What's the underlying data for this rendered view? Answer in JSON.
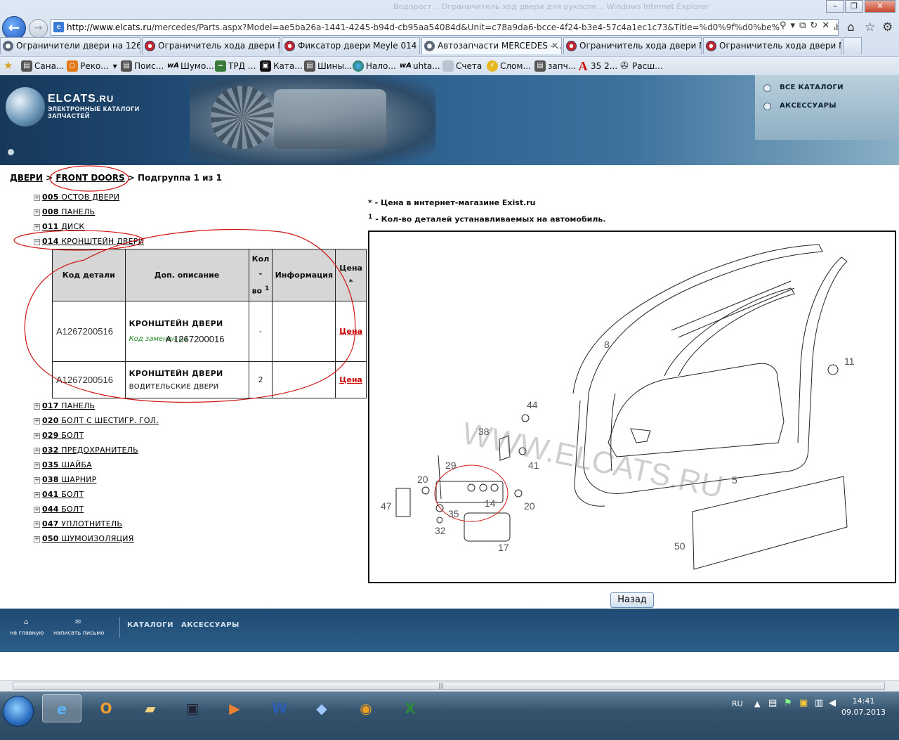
{
  "browser": {
    "url_domain": "http://www.elcats.ru",
    "url_rest": "/mercedes/Parts.aspx?Model=ae5ba26a-1441-4245-b94d-cb95aa54084d&Unit=c78a9da6-bcce-4f24-b3e4-57c4a1ec1c73&Title=%d0%9f%d0%be%d0%b4%d0%b3%d1%80%",
    "title_faded": "Водорост... Ограничитель ход двери для рукоспе... Windows Internet Explorer",
    "tabs": [
      {
        "label": "Ограничители двери на 126 л...",
        "active": false
      },
      {
        "label": "Ограничитель хода двери Ме...",
        "active": false
      },
      {
        "label": "Фиксатор двери Meyle 014 07...",
        "active": false
      },
      {
        "label": "Автозапчасти MERCEDES - ...",
        "active": true,
        "close": "✕"
      },
      {
        "label": "Ограничитель хода двери Ме...",
        "active": false
      },
      {
        "label": "Ограничитель хода двери Ме...",
        "active": false
      }
    ],
    "favorites": [
      "Сана...",
      "Реко...",
      "Поис...",
      "Шумо...",
      "ТРД ...",
      "Ката...",
      "Шины...",
      "Нало...",
      "uhta...",
      "Счета",
      "Слом...",
      "запч...",
      "35 2...",
      "Расш..."
    ]
  },
  "site": {
    "logo_name": "ELCATS",
    "logo_suffix": ".RU",
    "logo_sub1": "ЭЛЕКТРОННЫЕ КАТАЛОГИ",
    "logo_sub2": "ЗАПЧАСТЕЙ",
    "side_links": [
      "ВСЕ КАТАЛОГИ",
      "АКСЕССУАРЫ"
    ]
  },
  "breadcrumb": {
    "level1": "ДВЕРИ",
    "sep": ">",
    "level2": "FRONT DOORS",
    "current": "Подгруппа 1 из 1"
  },
  "tree": [
    {
      "code": "005",
      "name": "ОСТОВ ДВЕРИ",
      "expanded": false
    },
    {
      "code": "008",
      "name": "ПАНЕЛЬ",
      "expanded": false
    },
    {
      "code": "011",
      "name": "ДИСК",
      "expanded": false
    },
    {
      "code": "014",
      "name": "КРОНШТЕЙН ДВЕРИ",
      "expanded": true
    },
    {
      "code": "017",
      "name": "ПАНЕЛЬ",
      "expanded": false
    },
    {
      "code": "020",
      "name": "БОЛТ С ШЕСТИГР. ГОЛ.",
      "expanded": false
    },
    {
      "code": "029",
      "name": "БОЛТ",
      "expanded": false
    },
    {
      "code": "032",
      "name": "ПРЕДОХРАНИТЕЛЬ",
      "expanded": false
    },
    {
      "code": "035",
      "name": "ШАЙБА",
      "expanded": false
    },
    {
      "code": "038",
      "name": "ШАРНИР",
      "expanded": false
    },
    {
      "code": "041",
      "name": "БОЛТ",
      "expanded": false
    },
    {
      "code": "044",
      "name": "БОЛТ",
      "expanded": false
    },
    {
      "code": "047",
      "name": "УПЛОТНИТЕЛЬ",
      "expanded": false
    },
    {
      "code": "050",
      "name": "ШУМОИЗОЛЯЦИЯ",
      "expanded": false
    }
  ],
  "parts_table": {
    "headers": {
      "code": "Код детали",
      "desc": "Доп. описание",
      "qty_a": "Кол",
      "qty_b": "-",
      "qty_c": "во",
      "qty_sup": "1",
      "info": "Информация",
      "price_a": "Цена",
      "price_b": "*"
    },
    "rows": [
      {
        "code": "A1267200516",
        "name": "КРОНШТЕЙН ДВЕРИ",
        "replaced_label": "Код заменен на",
        "replaced_code": "A  1267200016",
        "note": "",
        "qty": "-",
        "info": "",
        "price": "Цена"
      },
      {
        "code": "A1267200516",
        "name": "КРОНШТЕЙН ДВЕРИ",
        "replaced_label": "",
        "replaced_code": "",
        "note": "ВОДИТЕЛЬСКИЕ ДВЕРИ",
        "qty": "2",
        "info": "",
        "price": "Цена"
      }
    ]
  },
  "notes": {
    "star_mark": "*",
    "star_text": " - Цена в интернет-магазине Exist.ru",
    "one_mark": "1",
    "one_text": " - Кол-во деталей устанавливаемых на автомобиль."
  },
  "diagram": {
    "watermark": "WWW.ELCATS.RU",
    "callouts": [
      "8",
      "11",
      "44",
      "38",
      "41",
      "29",
      "20",
      "47",
      "14",
      "20",
      "35",
      "32",
      "17",
      "5",
      "50"
    ]
  },
  "back_button": "Назад",
  "footer": {
    "home": "на главную",
    "write": "написать письмо",
    "catalogs": "КАТАЛОГИ",
    "accessories": "АКСЕССУАРЫ"
  },
  "taskbar": {
    "lang": "RU",
    "time": "14:41",
    "date": "09.07.2013"
  }
}
